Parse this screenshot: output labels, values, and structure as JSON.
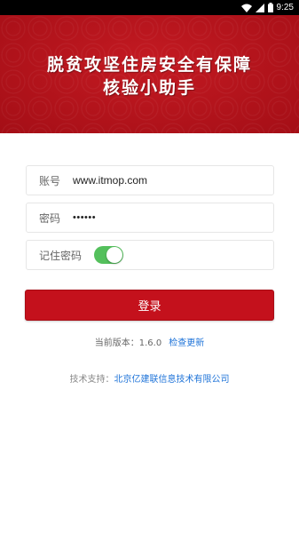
{
  "status_bar": {
    "time": "9:25",
    "icons": [
      "wifi-icon",
      "signal-icon",
      "battery-icon"
    ]
  },
  "banner": {
    "title_line1": "脱贫攻坚住房安全有保障",
    "title_line2": "核验小助手",
    "color": "#b3121a"
  },
  "form": {
    "username_label": "账号",
    "username_value": "www.itmop.com",
    "password_label": "密码",
    "password_masked": "••••••",
    "remember_label": "记住密码",
    "remember_checked": true,
    "toggle_color": "#54c05c"
  },
  "login_button": {
    "label": "登录",
    "color": "#c4111c"
  },
  "version": {
    "prefix": "当前版本：",
    "number": "1.6.0",
    "check_update": "检查更新"
  },
  "support": {
    "prefix": "技术支持：",
    "company": "北京亿建联信息技术有限公司"
  },
  "colors": {
    "link": "#1e73d8"
  }
}
